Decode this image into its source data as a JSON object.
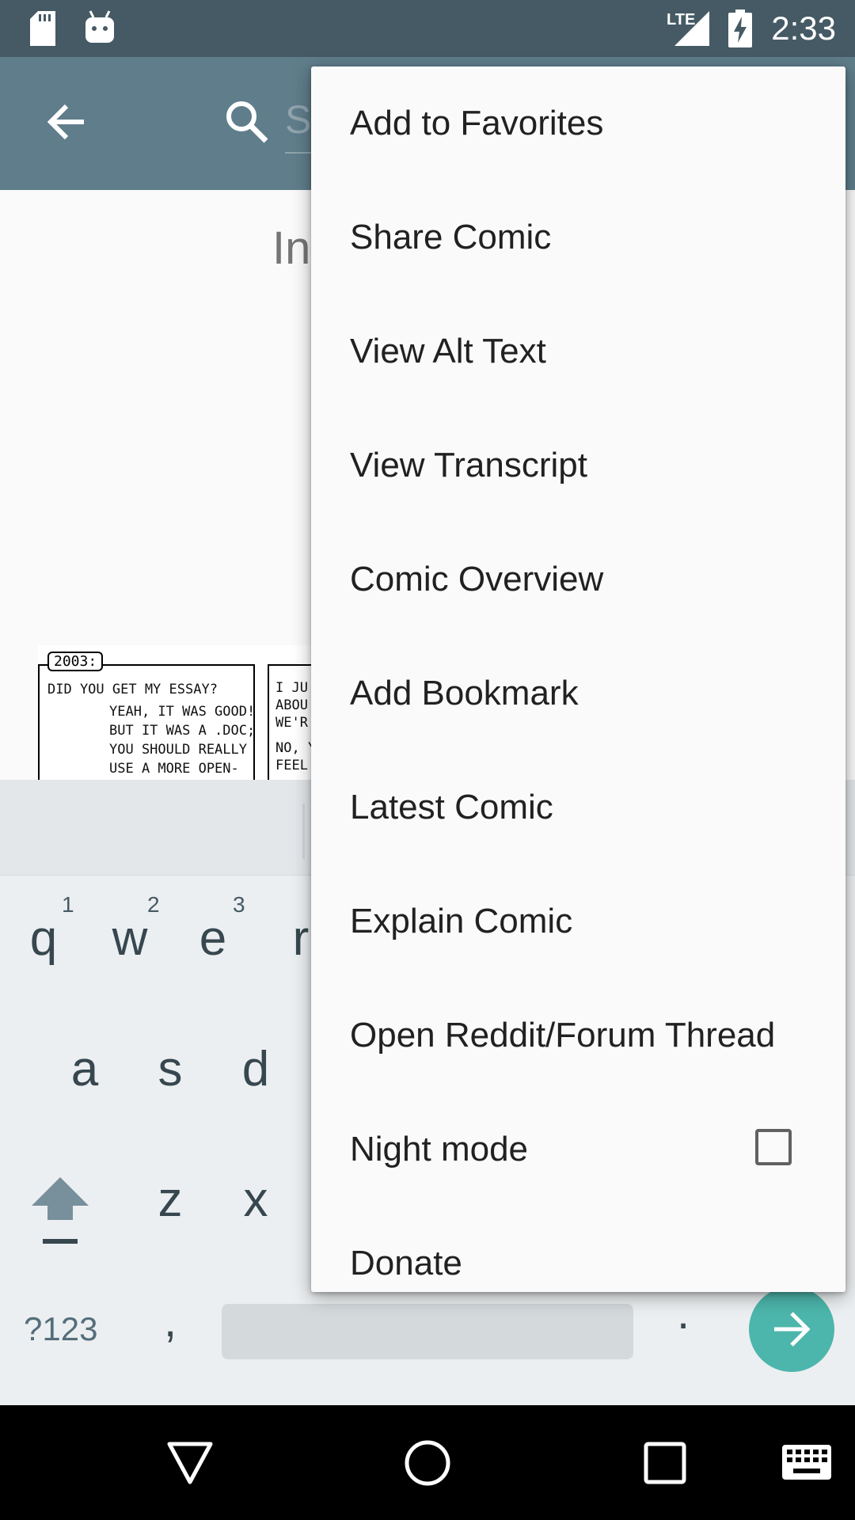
{
  "status_bar": {
    "time": "2:33",
    "network": "LTE",
    "icons": [
      "sd-card-icon",
      "android-icon",
      "signal-icon",
      "battery-charging-icon"
    ]
  },
  "toolbar": {
    "back_icon": "arrow-back-icon",
    "search_icon": "search-icon",
    "search_placeholder": "S"
  },
  "content": {
    "title_partial": "In",
    "comic_text": {
      "year_label": "2003:",
      "line1": "DID YOU GET MY ESSAY?",
      "line2": "YEAH, IT WAS GOOD!",
      "line3": "BUT IT WAS A .DOC;",
      "line4": "YOU SHOULD REALLY",
      "line5": "USE A MORE OPEN-",
      "panel2_l1": "I JU",
      "panel2_l2": "ABOU",
      "panel2_l3": "WE'R",
      "panel2_l4": "NO, Y",
      "panel2_l5": "FEEL"
    }
  },
  "menu": {
    "items": [
      {
        "label": "Add to Favorites"
      },
      {
        "label": "Share Comic"
      },
      {
        "label": "View Alt Text"
      },
      {
        "label": "View Transcript"
      },
      {
        "label": "Comic Overview"
      },
      {
        "label": "Add Bookmark"
      },
      {
        "label": "Latest Comic"
      },
      {
        "label": "Explain Comic"
      },
      {
        "label": "Open Reddit/Forum Thread"
      },
      {
        "label": "Night mode",
        "checked": false
      },
      {
        "label": "Donate"
      }
    ]
  },
  "keyboard": {
    "row1": [
      "q",
      "w",
      "e",
      "r"
    ],
    "row1_hints": [
      "1",
      "2",
      "3"
    ],
    "row2": [
      "a",
      "s",
      "d"
    ],
    "row3": [
      "z",
      "x"
    ],
    "symbols_key": "?123",
    "comma_key": ",",
    "period_key": ".",
    "shift_icon": "shift-icon",
    "go_icon": "arrow-forward-icon"
  },
  "nav_bar": {
    "icons": [
      "back-triangle-icon",
      "home-circle-icon",
      "recents-square-icon",
      "keyboard-icon"
    ]
  },
  "colors": {
    "status_bar": "#455a64",
    "toolbar": "#607d8b",
    "accent": "#4db6ac",
    "menu_bg": "#fafafa"
  }
}
